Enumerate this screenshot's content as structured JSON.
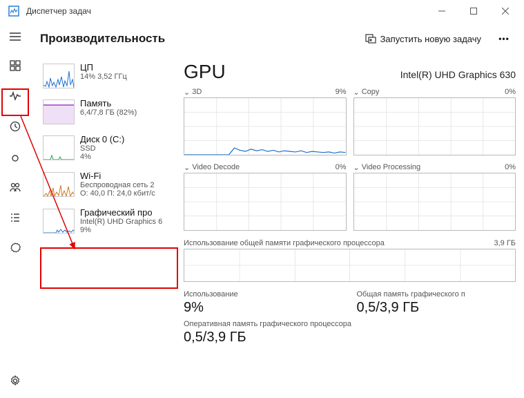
{
  "titlebar": {
    "title": "Диспетчер задач"
  },
  "header": {
    "page_title": "Производительность",
    "new_task": "Запустить новую задачу"
  },
  "side": {
    "items": [
      {
        "title": "ЦП",
        "sub": "14% 3,52 ГГц"
      },
      {
        "title": "Память",
        "sub": "6,4/7,8 ГБ (82%)"
      },
      {
        "title": "Диск 0 (C:)",
        "sub": "SSD",
        "sub2": "4%"
      },
      {
        "title": "Wi-Fi",
        "sub": "Беспроводная сеть 2",
        "sub2": "О: 40,0 П: 24,0 кбит/с"
      },
      {
        "title": "Графический про",
        "sub": "Intel(R) UHD Graphics 6",
        "sub2": "9%"
      }
    ]
  },
  "detail": {
    "name": "GPU",
    "model": "Intel(R) UHD Graphics 630",
    "charts": [
      {
        "label": "3D",
        "value": "9%"
      },
      {
        "label": "Copy",
        "value": "0%"
      },
      {
        "label": "Video Decode",
        "value": "0%"
      },
      {
        "label": "Video Processing",
        "value": "0%"
      }
    ],
    "shared": {
      "label": "Использование общей памяти графического процессора",
      "value": "3,9 ГБ"
    },
    "stats": [
      {
        "label": "Использование",
        "value": "9%"
      },
      {
        "label": "Общая память графического п",
        "value": "0,5/3,9 ГБ"
      },
      {
        "label": "Оперативная память графического процессора",
        "value": "0,5/3,9 ГБ"
      }
    ]
  },
  "chart_data": {
    "type": "line",
    "title": "GPU 3D utilisation",
    "xlabel": "",
    "ylabel": "%",
    "ylim": [
      0,
      100
    ],
    "x": [
      0,
      1,
      2,
      3,
      4,
      5,
      6,
      7,
      8,
      9,
      10,
      11,
      12,
      13,
      14,
      15,
      16,
      17,
      18,
      19,
      20,
      21,
      22,
      23,
      24,
      25,
      26,
      27,
      28,
      29
    ],
    "series": [
      {
        "name": "3D",
        "values": [
          0,
          0,
          0,
          0,
          0,
          0,
          0,
          0,
          0,
          12,
          8,
          6,
          10,
          7,
          9,
          6,
          8,
          5,
          7,
          6,
          5,
          7,
          4,
          6,
          5,
          4,
          5,
          3,
          5,
          4
        ]
      },
      {
        "name": "Copy",
        "values": [
          0,
          0,
          0,
          0,
          0,
          0,
          0,
          0,
          0,
          0,
          0,
          0,
          0,
          0,
          0,
          0,
          0,
          0,
          0,
          0,
          0,
          0,
          0,
          0,
          0,
          0,
          0,
          0,
          0,
          0
        ]
      },
      {
        "name": "Video Decode",
        "values": [
          0,
          0,
          0,
          0,
          0,
          0,
          0,
          0,
          0,
          0,
          0,
          0,
          0,
          0,
          0,
          0,
          0,
          0,
          0,
          0,
          0,
          0,
          0,
          0,
          0,
          0,
          0,
          0,
          0,
          0
        ]
      },
      {
        "name": "Video Processing",
        "values": [
          0,
          0,
          0,
          0,
          0,
          0,
          0,
          0,
          0,
          0,
          0,
          0,
          0,
          0,
          0,
          0,
          0,
          0,
          0,
          0,
          0,
          0,
          0,
          0,
          0,
          0,
          0,
          0,
          0,
          0
        ]
      }
    ]
  }
}
